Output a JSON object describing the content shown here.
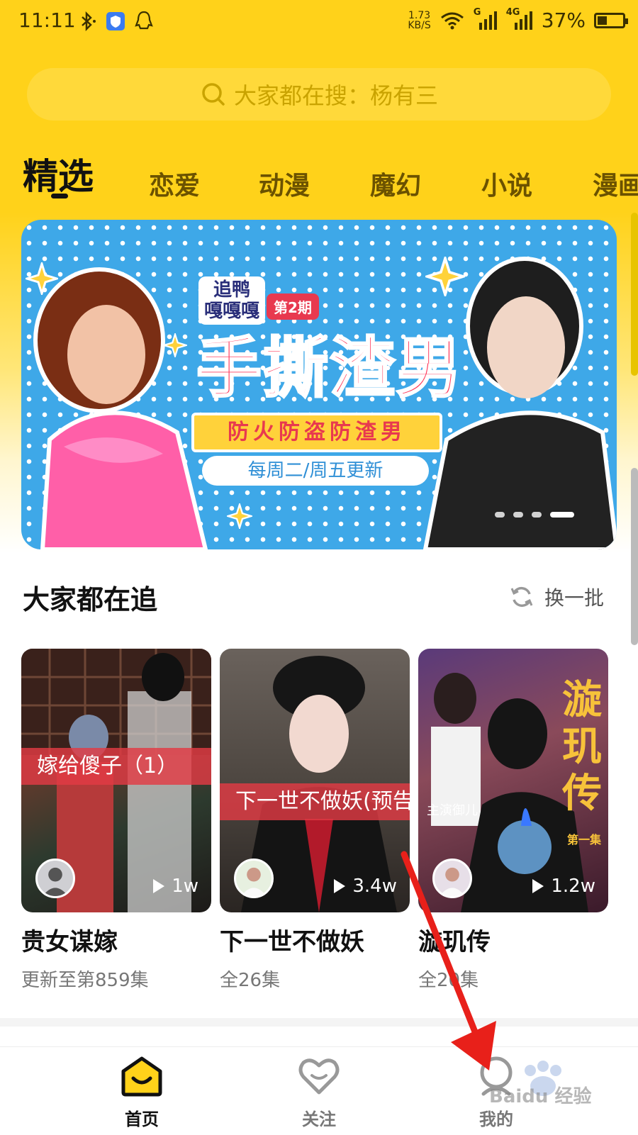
{
  "status_bar": {
    "time": "11:11",
    "speed_value": "1.73",
    "speed_unit": "KB/S",
    "sim1": "G",
    "sim2": "4G",
    "battery": "37%",
    "battery_level": 0.37
  },
  "search": {
    "placeholder": "大家都在搜：杨有三"
  },
  "tabs": [
    {
      "label": "精选",
      "active": true
    },
    {
      "label": "恋爱"
    },
    {
      "label": "动漫"
    },
    {
      "label": "魔幻"
    },
    {
      "label": "小说"
    },
    {
      "label": "漫画"
    }
  ],
  "banner": {
    "brand": "追鸭\n嘎嘎嘎",
    "issue": "第2期",
    "title": "手撕渣男",
    "subtitle": "防火防盗防渣男",
    "schedule": "每周二/周五更新",
    "page_count": 4,
    "active_page": 4
  },
  "section": {
    "title": "大家都在追",
    "refresh_label": "换一批"
  },
  "cards": [
    {
      "overlay": "嫁给傻子（1）",
      "plays": "1w",
      "title": "贵女谋嫁",
      "sub": "更新至第859集"
    },
    {
      "overlay": "下一世不做妖(预告)",
      "plays": "3.4w",
      "title": "下一世不做妖",
      "sub": "全26集"
    },
    {
      "overlay": "",
      "plays": "1.2w",
      "title": "漩玑传",
      "sub": "全20集",
      "poster_text": "漩玑传",
      "poster_sub": "第一集",
      "poster_cast": "主演御儿"
    }
  ],
  "bottom_nav": [
    {
      "label": "首页",
      "active": true
    },
    {
      "label": "关注"
    },
    {
      "label": "我的"
    }
  ],
  "watermark": "Baidu 经验",
  "colors": {
    "brand_yellow": "#ffd21a",
    "overlay_red": "#e23a44",
    "annotation_arrow": "#e8201a"
  }
}
